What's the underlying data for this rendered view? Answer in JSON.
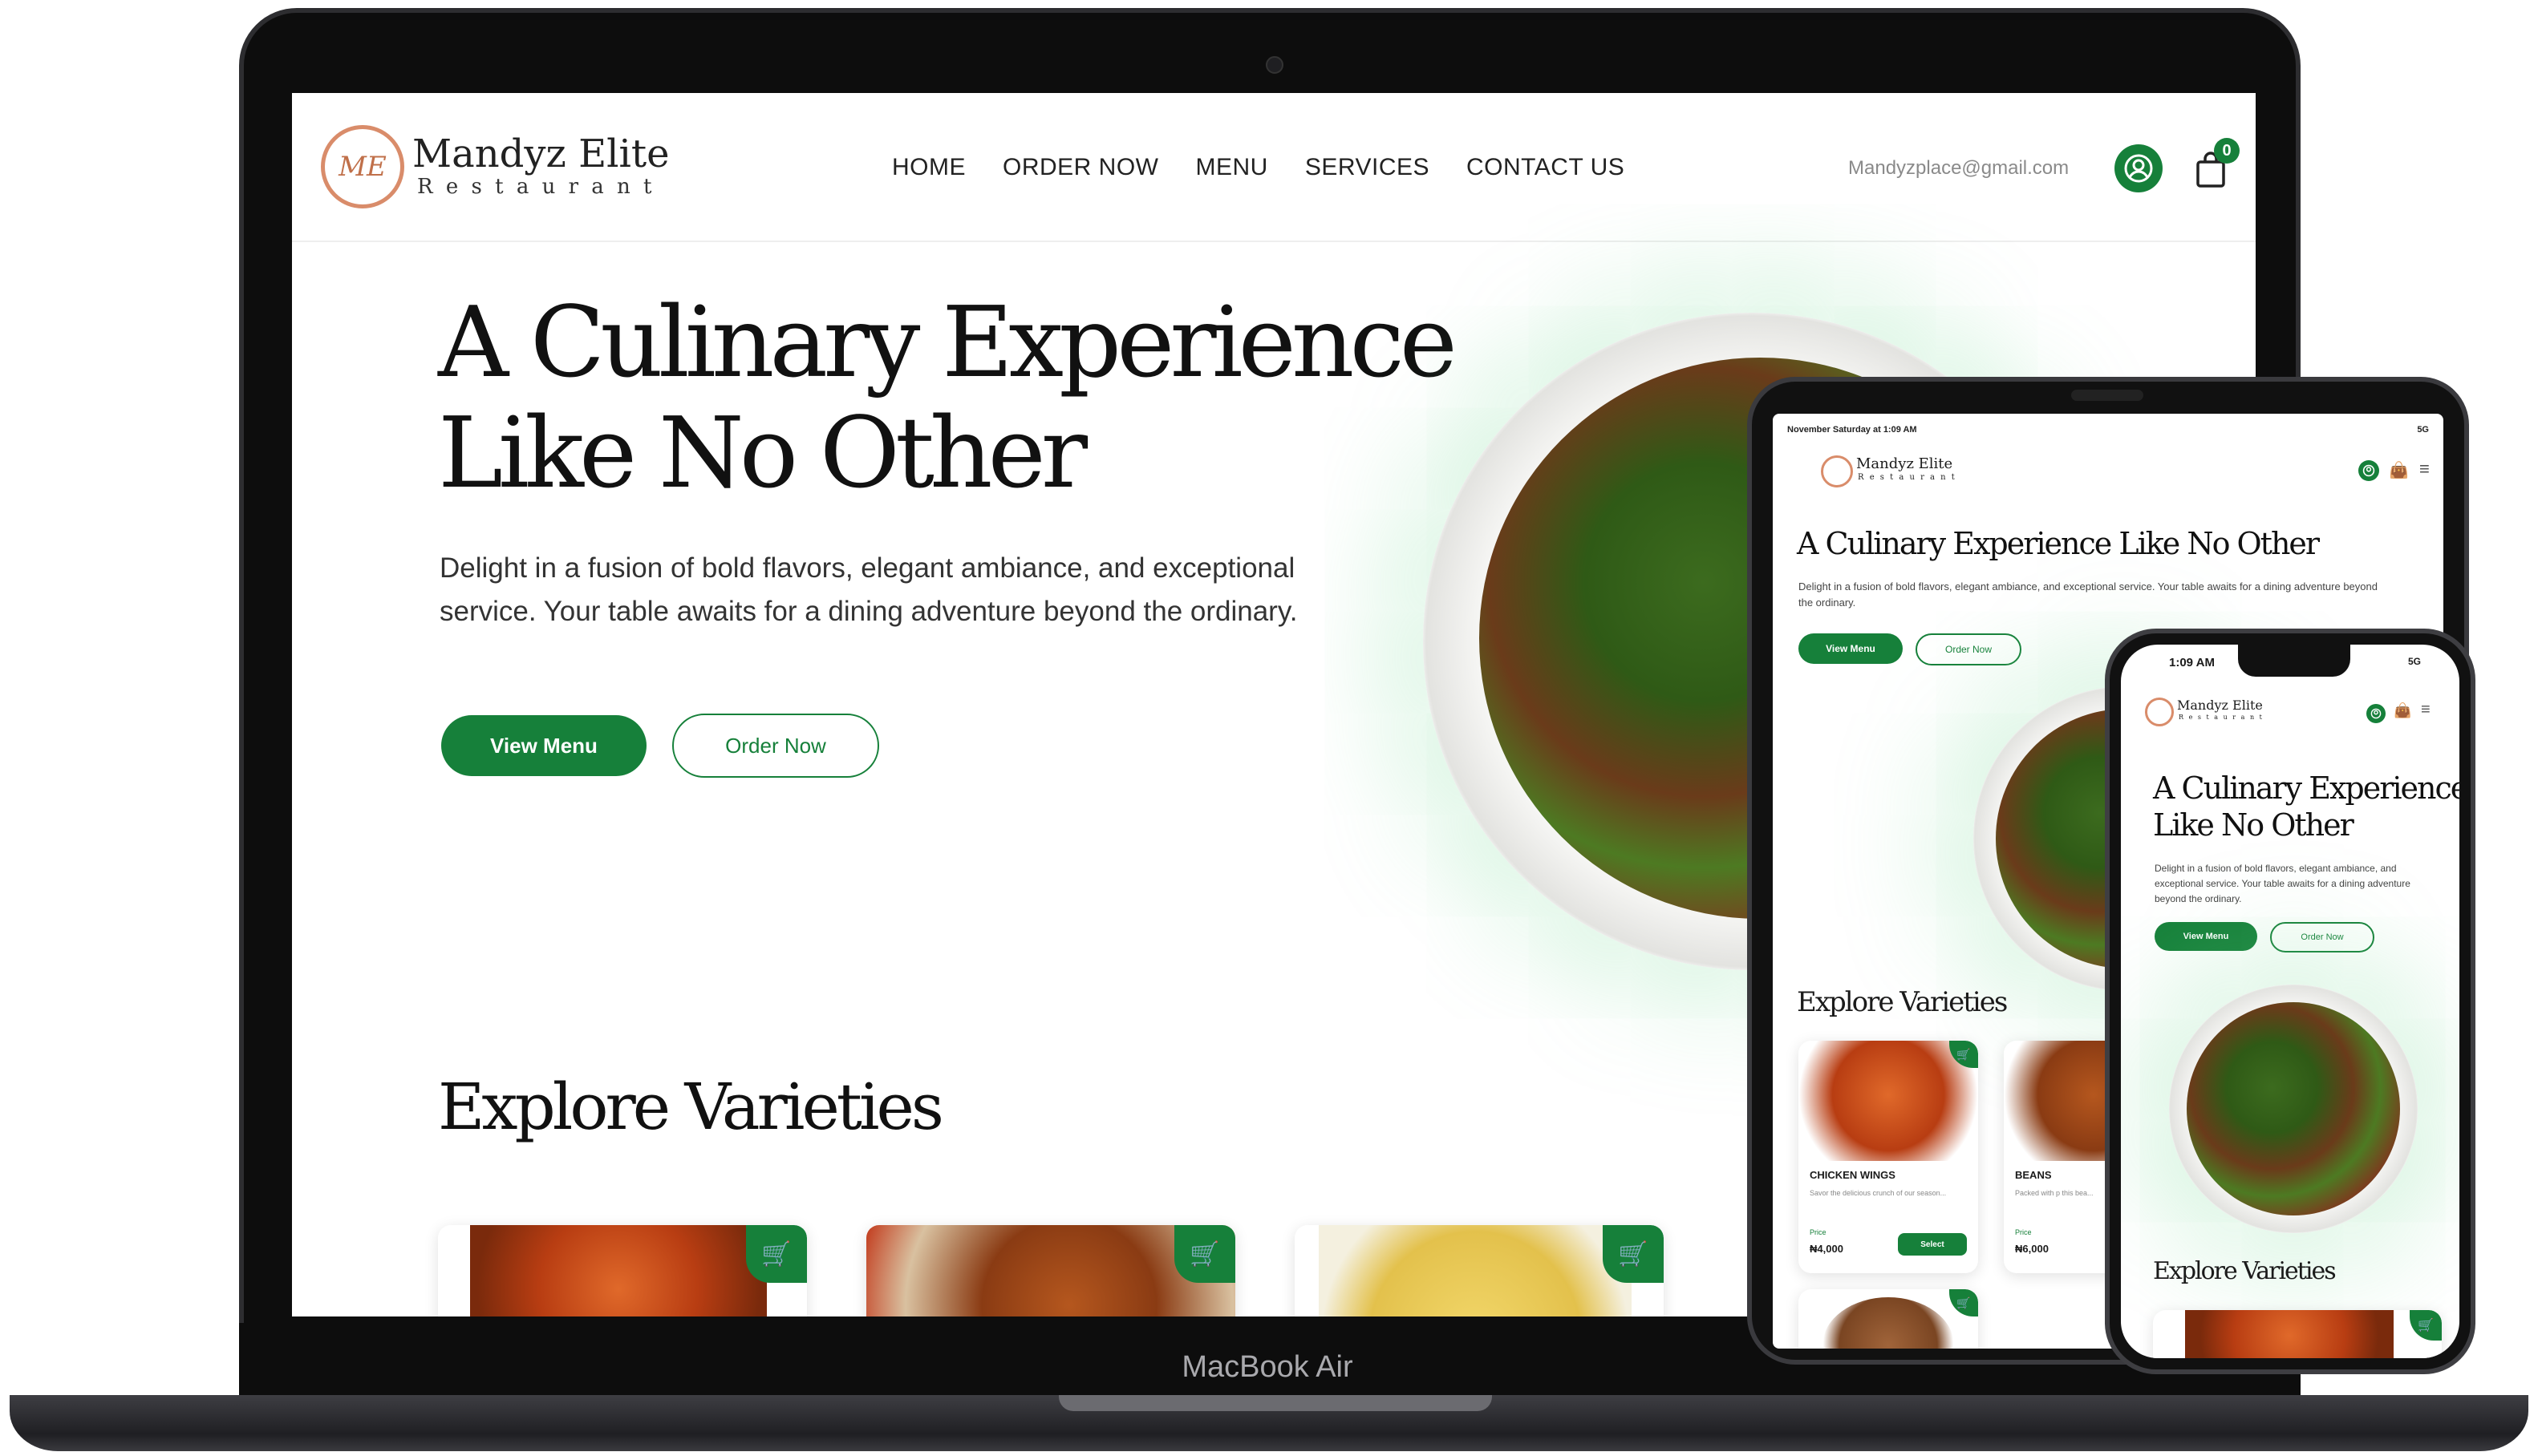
{
  "brand": {
    "name": "Mandyz Elite",
    "sub": "R e s t a u r a n t",
    "monogram": "ME"
  },
  "nav": {
    "items": [
      "HOME",
      "ORDER NOW",
      "MENU",
      "SERVICES",
      "CONTACT US"
    ]
  },
  "header": {
    "email": "Mandyzplace@gmail.com",
    "cart_count": "0"
  },
  "hero": {
    "title_line1": "A Culinary Experience",
    "title_line2": "Like No Other",
    "title_full": "A Culinary Experience Like No Other",
    "description": "Delight in a fusion of bold flavors, elegant ambiance, and exceptional service. Your table awaits for a dining adventure beyond the ordinary.",
    "view_menu": "View Menu",
    "order_now": "Order Now"
  },
  "section": {
    "explore": "Explore Varieties"
  },
  "device": {
    "laptop_label": "MacBook Air",
    "tablet_status": "November Saturday at 1:09 AM",
    "tablet_signal": "5G",
    "phone_time": "1:09 AM",
    "phone_signal": "5G"
  },
  "products": [
    {
      "name": "CHICKEN WINGS",
      "desc": "Savor the delicious crunch of our season...",
      "price_label": "Price",
      "price": "₦4,000",
      "action": "Select"
    },
    {
      "name": "BEANS",
      "desc": "Packed with p this bea...",
      "price_label": "Price",
      "price": "₦6,000"
    }
  ],
  "colors": {
    "accent": "#16803a",
    "text": "#1b1b1b",
    "muted": "#8a8a8a"
  },
  "icons": {
    "user": "user-circle-icon",
    "cart": "shopping-bag-icon",
    "basket": "cart-icon",
    "menu": "hamburger-icon"
  }
}
